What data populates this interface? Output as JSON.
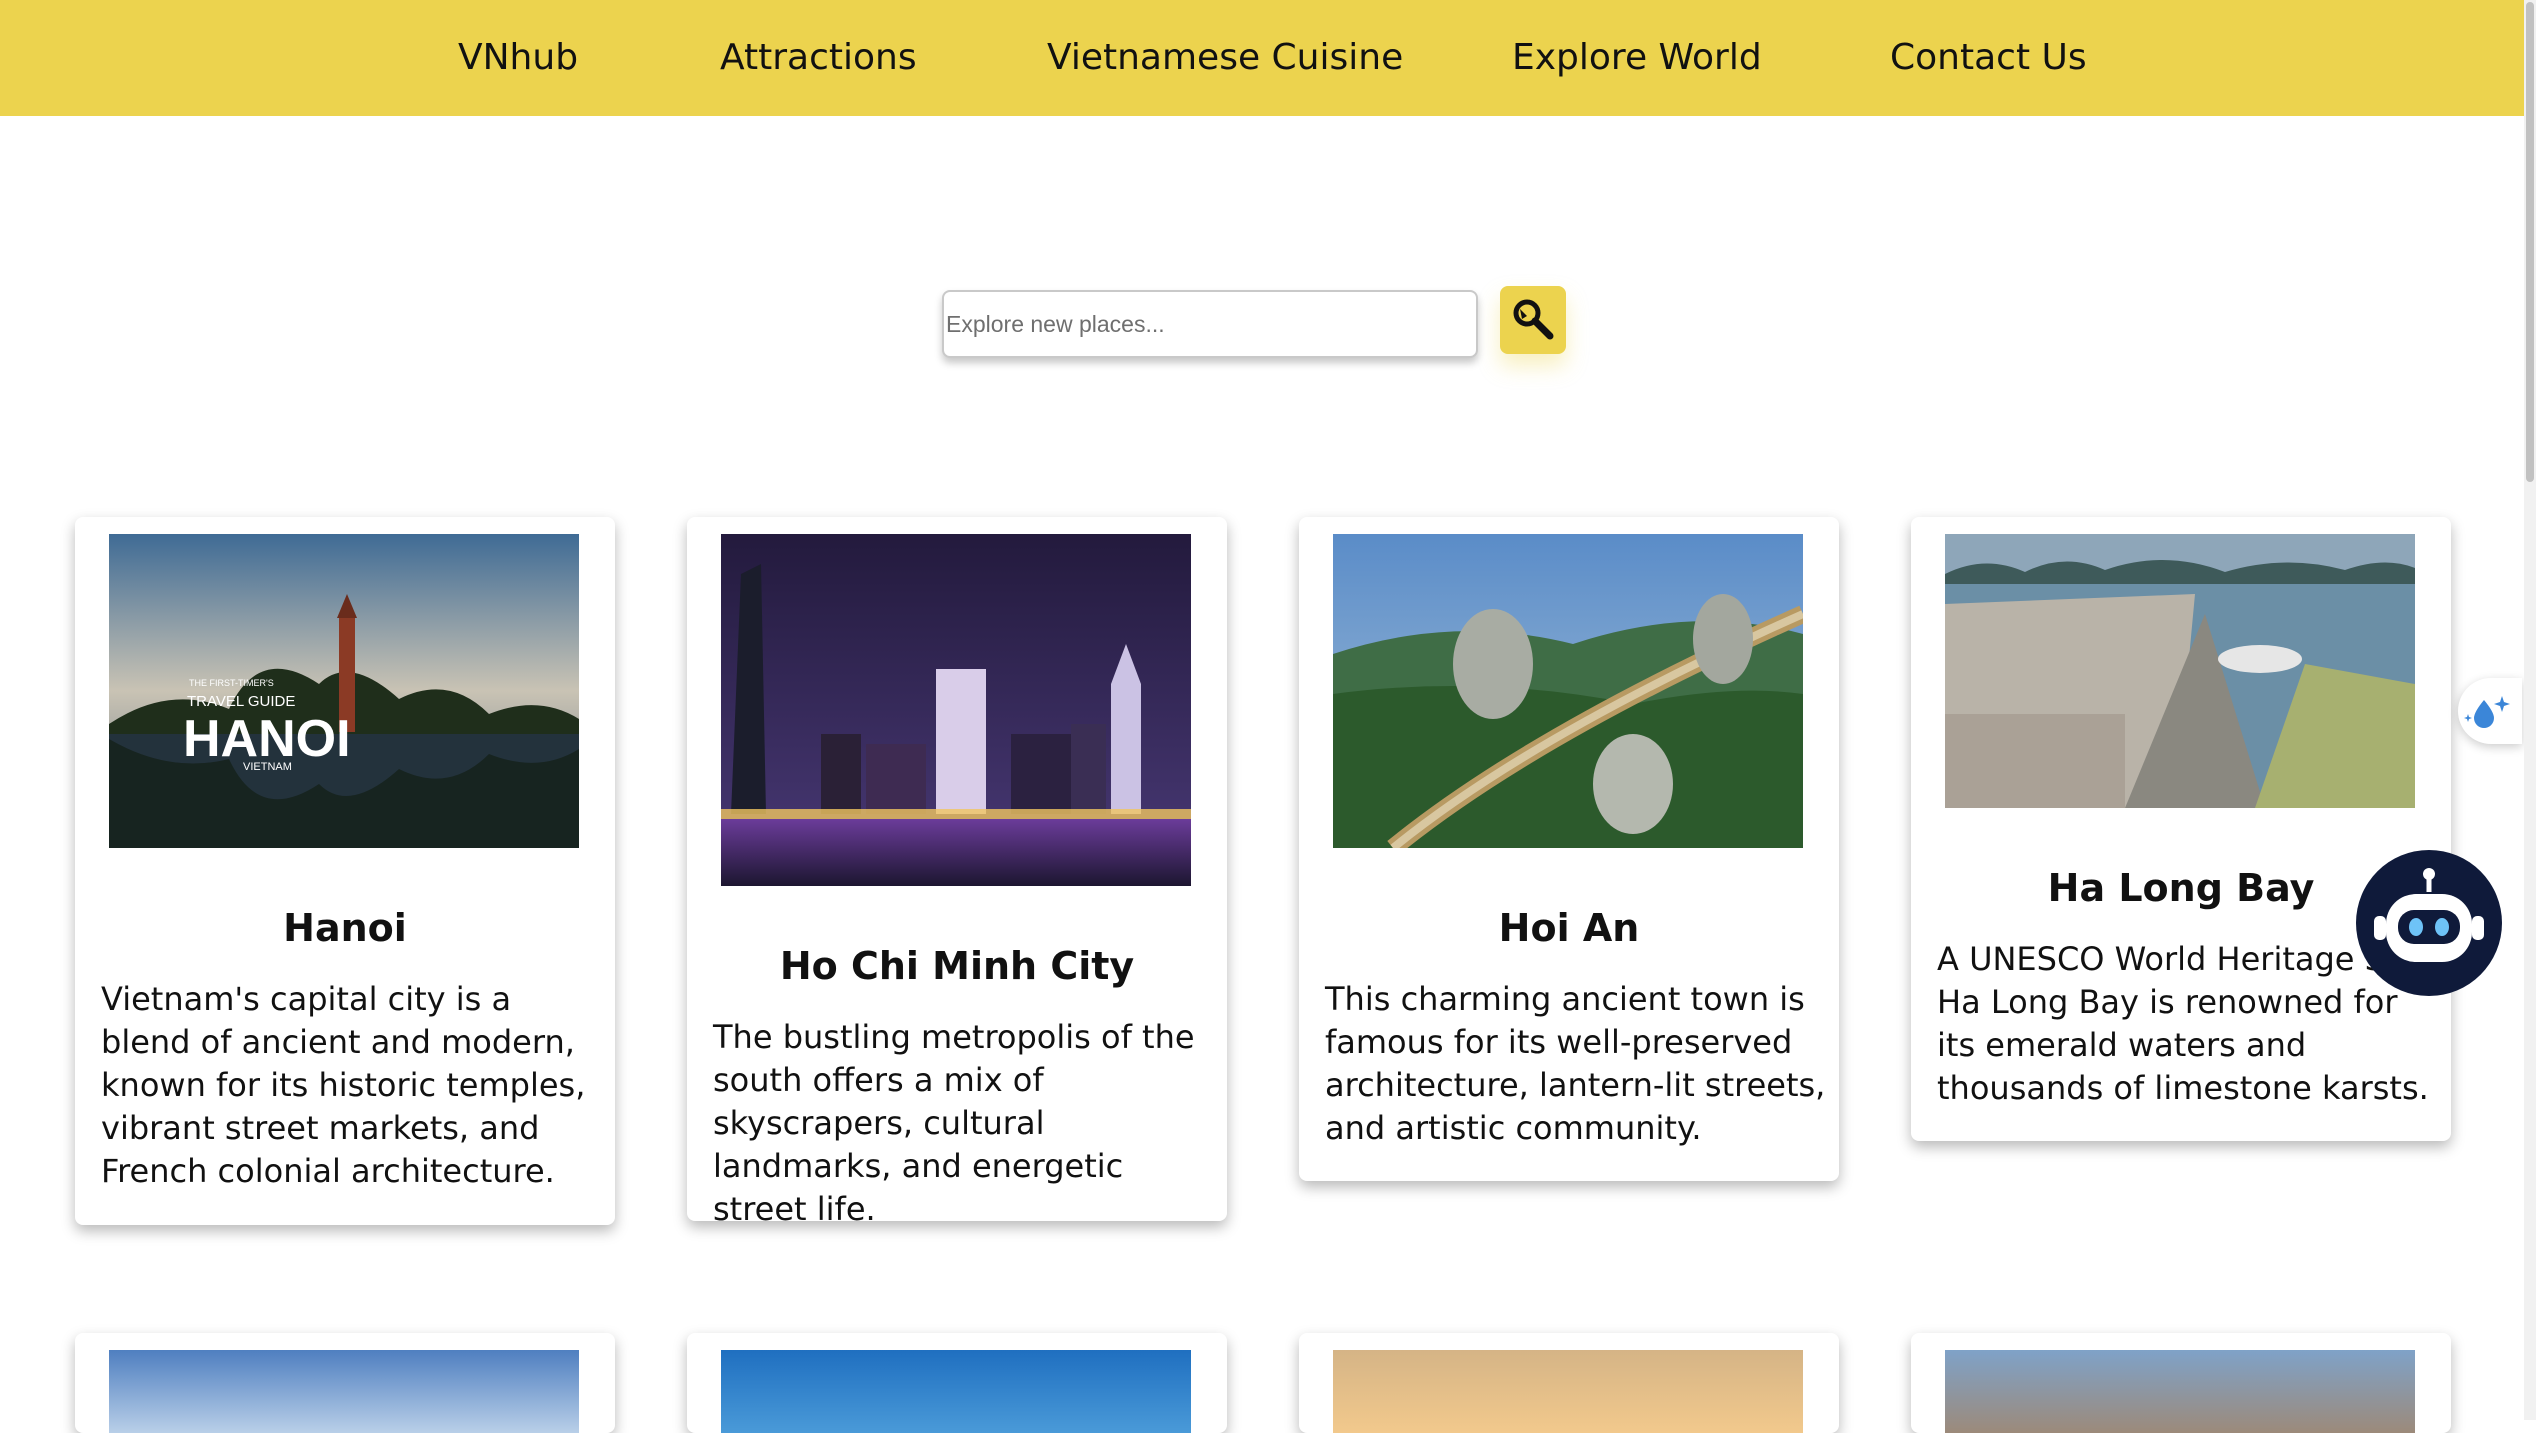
{
  "nav": {
    "items": [
      "VNhub",
      "Attractions",
      "Vietnamese Cuisine",
      "Explore World",
      "Contact Us"
    ]
  },
  "search": {
    "placeholder": "Explore new places...",
    "button_icon": "search-icon"
  },
  "cards": [
    {
      "title": "Hanoi",
      "description": "Vietnam's capital city is a blend of ancient and modern, known for its historic temples, vibrant street markets, and French colonial architecture.",
      "image_text": [
        "THE FIRST-TIMER'S",
        "TRAVEL GUIDE",
        "HANOI",
        "VIETNAM"
      ]
    },
    {
      "title": "Ho Chi Minh City",
      "description": "The bustling metropolis of the south offers a mix of skyscrapers, cultural landmarks, and energetic street life."
    },
    {
      "title": "Hoi An",
      "description": "This charming ancient town is famous for its well-preserved architecture, lantern-lit streets, and artistic community."
    },
    {
      "title": "Ha Long Bay",
      "description": "A UNESCO World Heritage Site, Ha Long Bay is renowned for its emerald waters and thousands of limestone karsts."
    }
  ],
  "colors": {
    "nav_bg": "#ecd34e",
    "accent": "#ecd34e",
    "bot_bg": "#0f1a3a"
  },
  "floating": {
    "side_tab_icon": "water-drop-sparkle-icon",
    "chatbot_icon": "robot-icon"
  }
}
